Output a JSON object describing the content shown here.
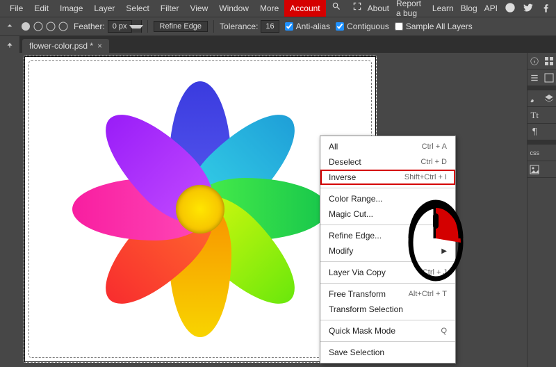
{
  "menu": {
    "file": "File",
    "edit": "Edit",
    "image": "Image",
    "layer": "Layer",
    "select": "Select",
    "filter": "Filter",
    "view": "View",
    "window": "Window",
    "more": "More",
    "account": "Account"
  },
  "topright": {
    "about": "About",
    "report": "Report a bug",
    "learn": "Learn",
    "blog": "Blog",
    "api": "API"
  },
  "optbar": {
    "feather_label": "Feather:",
    "feather_val": "0 px",
    "refine": "Refine Edge",
    "tol_label": "Tolerance:",
    "tol_val": "16",
    "aa": "Anti-alias",
    "contig": "Contiguous",
    "sampleall": "Sample All Layers"
  },
  "tab": {
    "name": "flower-color.psd *"
  },
  "ctx": {
    "all": {
      "l": "All",
      "s": "Ctrl + A"
    },
    "deselect": {
      "l": "Deselect",
      "s": "Ctrl + D"
    },
    "inverse": {
      "l": "Inverse",
      "s": "Shift+Ctrl + I"
    },
    "colorrange": {
      "l": "Color Range..."
    },
    "magiccut": {
      "l": "Magic Cut..."
    },
    "refine": {
      "l": "Refine Edge..."
    },
    "modify": {
      "l": "Modify"
    },
    "lvc": {
      "l": "Layer Via Copy",
      "s": "Ctrl + J"
    },
    "ft": {
      "l": "Free Transform",
      "s": "Alt+Ctrl + T"
    },
    "ts": {
      "l": "Transform Selection"
    },
    "qmm": {
      "l": "Quick Mask Mode",
      "s": "Q"
    },
    "save": {
      "l": "Save Selection"
    }
  },
  "colors": {
    "accent": "#d50000",
    "highlight": "#d40000"
  }
}
